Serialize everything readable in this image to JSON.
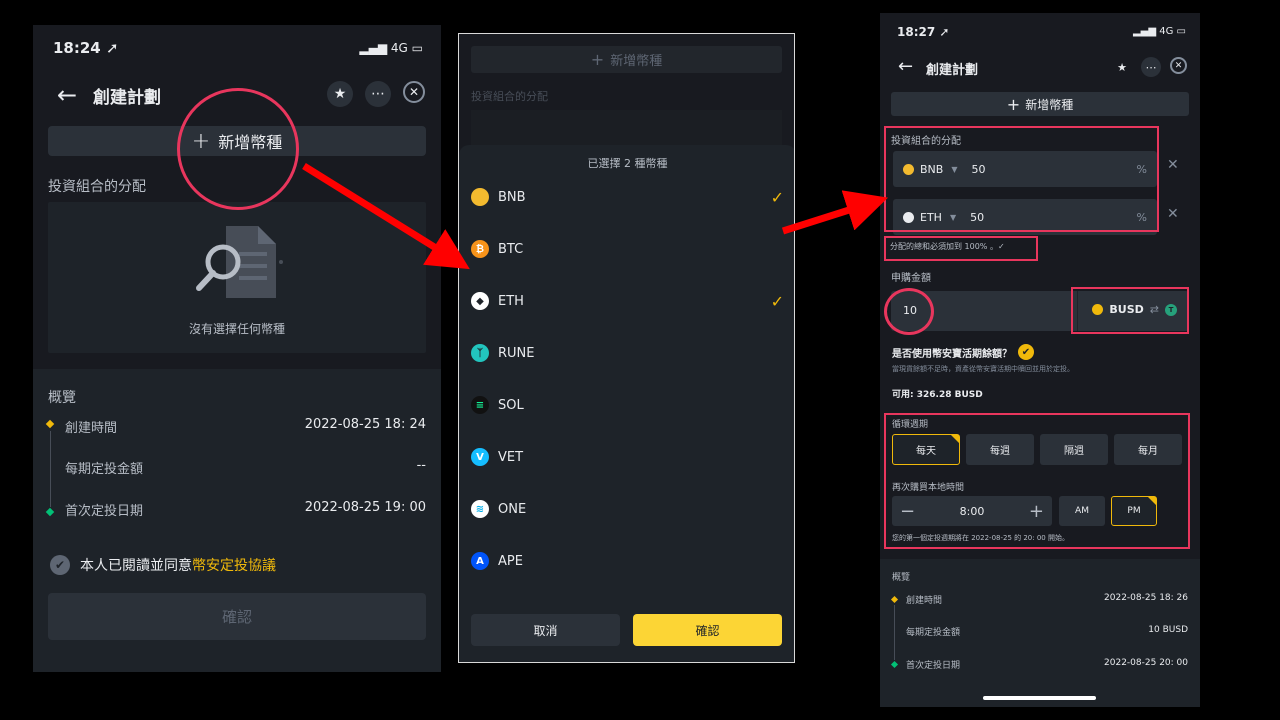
{
  "colors": {
    "accent": "#f0b90b",
    "annotation": "#e8365d",
    "arrow": "#ff0000"
  },
  "phone1": {
    "status_time": "18:24 ➚",
    "status_net": "4G",
    "title": "創建計劃",
    "add_coin": "新增幣種",
    "allocation_label": "投資組合的分配",
    "empty_text": "沒有選擇任何幣種",
    "overview": {
      "title": "概覽",
      "rows": [
        {
          "label": "創建時間",
          "value": "2022-08-25 18: 24"
        },
        {
          "label": "每期定投金額",
          "value": "--"
        },
        {
          "label": "首次定投日期",
          "value": "2022-08-25 19: 00"
        }
      ]
    },
    "agree_prefix": "本人已閱讀並同意",
    "agree_link": "幣安定投協議",
    "confirm": "確認"
  },
  "phone2": {
    "top_add": "新增幣種",
    "top_label": "投資組合的分配",
    "sheet_header": "已選擇 2 種幣種",
    "coins": [
      {
        "name": "BNB",
        "selected": true,
        "icon": "bnb-icon",
        "color": "#f3ba2f"
      },
      {
        "name": "BTC",
        "selected": false,
        "icon": "btc-icon",
        "color": "#f7931a"
      },
      {
        "name": "ETH",
        "selected": true,
        "icon": "eth-icon",
        "color": "#ffffff"
      },
      {
        "name": "RUNE",
        "selected": false,
        "icon": "rune-icon",
        "color": "#22c5be"
      },
      {
        "name": "SOL",
        "selected": false,
        "icon": "sol-icon",
        "color": "#111111"
      },
      {
        "name": "VET",
        "selected": false,
        "icon": "vet-icon",
        "color": "#15bdff"
      },
      {
        "name": "ONE",
        "selected": false,
        "icon": "one-icon",
        "color": "#ffffff"
      },
      {
        "name": "APE",
        "selected": false,
        "icon": "ape-icon",
        "color": "#0054f9"
      }
    ],
    "cancel": "取消",
    "confirm": "確認"
  },
  "phone3": {
    "status_time": "18:27 ➚",
    "status_net": "4G",
    "title": "創建計劃",
    "add_coin": "新增幣種",
    "allocation_label": "投資組合的分配",
    "allocations": [
      {
        "coin": "BNB",
        "value": "50",
        "unit": "%"
      },
      {
        "coin": "ETH",
        "value": "50",
        "unit": "%"
      }
    ],
    "sum_note": "分配的總和必須加到 100% 。✓",
    "amount_label": "申購金額",
    "amount_value": "10",
    "currency": "BUSD",
    "earn_question": "是否使用幣安寶活期餘額？",
    "earn_note": "當現貨餘額不足時，資產從幣安寶活期中贖回並用於定投。",
    "available": "可用: 326.28 BUSD",
    "cycle_label": "循環週期",
    "cycles": [
      "每天",
      "每週",
      "隔週",
      "每月"
    ],
    "cycle_selected": "每天",
    "time_label": "再次購買本地時間",
    "time_value": "8:00",
    "am": "AM",
    "pm": "PM",
    "first_note": "您的第一個定投週期將在 2022-08-25 的 20: 00 開始。",
    "overview": {
      "title": "概覽",
      "rows": [
        {
          "label": "創建時間",
          "value": "2022-08-25 18: 26"
        },
        {
          "label": "每期定投金額",
          "value": "10 BUSD"
        },
        {
          "label": "首次定投日期",
          "value": "2022-08-25 20: 00"
        }
      ]
    }
  }
}
